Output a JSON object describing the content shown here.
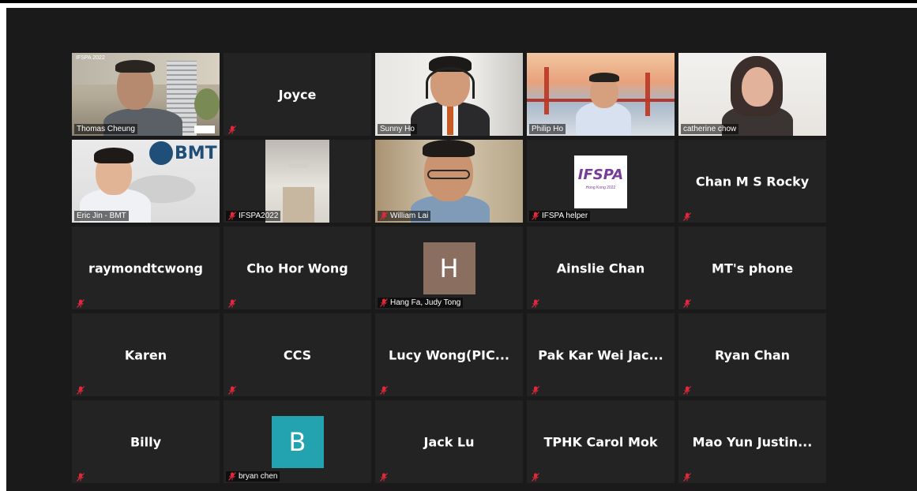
{
  "participants": [
    {
      "name": "Thomas Cheung",
      "type": "video",
      "muted": false
    },
    {
      "name": "Joyce",
      "type": "name",
      "muted": true
    },
    {
      "name": "Sunny Ho",
      "type": "video",
      "muted": false
    },
    {
      "name": "Philip Ho",
      "type": "video",
      "muted": false
    },
    {
      "name": "catherine chow",
      "type": "video",
      "muted": false
    },
    {
      "name": "Eric Jin - BMT",
      "type": "video",
      "muted": false,
      "active_speaker": true
    },
    {
      "name": "IFSPA2022",
      "type": "video",
      "muted": true
    },
    {
      "name": "William Lai",
      "type": "video",
      "muted": true
    },
    {
      "name": "IFSPA helper",
      "type": "video",
      "muted": true
    },
    {
      "name": "Chan M S Rocky",
      "type": "name",
      "muted": true
    },
    {
      "name": "raymondtcwong",
      "type": "name",
      "muted": true
    },
    {
      "name": "Cho Hor Wong",
      "type": "name",
      "muted": true
    },
    {
      "name": "Hang Fa, Judy Tong",
      "type": "avatar",
      "initial": "H",
      "avatar_color": "#8a6f61",
      "muted": true
    },
    {
      "name": "Ainslie Chan",
      "type": "name",
      "muted": true
    },
    {
      "name": "MT's phone",
      "type": "name",
      "muted": true
    },
    {
      "name": "Karen",
      "type": "name",
      "muted": true
    },
    {
      "name": "CCS",
      "type": "name",
      "muted": true
    },
    {
      "name": "Lucy Wong(PIC...",
      "type": "name",
      "muted": true
    },
    {
      "name": "Pak Kar Wei Jac...",
      "type": "name",
      "muted": true
    },
    {
      "name": "Ryan Chan",
      "type": "name",
      "muted": true
    },
    {
      "name": "Billy",
      "type": "name",
      "muted": true
    },
    {
      "name": "bryan chen",
      "type": "avatar",
      "initial": "B",
      "avatar_color": "#23a3b0",
      "muted": true
    },
    {
      "name": "Jack Lu",
      "type": "name",
      "muted": true
    },
    {
      "name": "TPHK Carol Mok",
      "type": "name",
      "muted": true
    },
    {
      "name": "Mao Yun Justin...",
      "type": "name",
      "muted": true
    }
  ],
  "video_text": {
    "bmt_logo": "BMT",
    "ifspa_logo": "IFSPA",
    "ifspa_sub": "Hong Kong 2022",
    "slide_title": "IFSPA 2022"
  },
  "colors": {
    "background": "#1a1a1a",
    "tile": "#232323",
    "active_border": "#e9e377",
    "muted_icon": "#e0283c"
  },
  "icons": {
    "muted": "microphone-muted-icon"
  }
}
